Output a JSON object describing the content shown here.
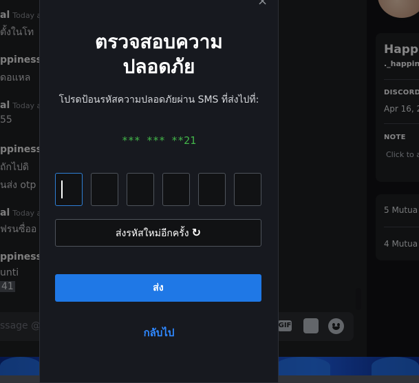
{
  "chat": {
    "messages": [
      {
        "author": "al",
        "time": "Today a",
        "body": "ตั้งในโท"
      },
      {
        "author": "ppiness",
        "time": "",
        "body": "ดอแหล"
      },
      {
        "author": "al",
        "time": "Today a",
        "body": "55"
      },
      {
        "author": "ppiness",
        "time": "",
        "body": "ถักไปดิ"
      },
      {
        "author": "",
        "time": "",
        "body": "นส่ง otp"
      },
      {
        "author": "al",
        "time": "Today a",
        "body": "ฟรนซื่ออ"
      },
      {
        "author": "ppiness",
        "time": "",
        "body": "unti"
      },
      {
        "author": "",
        "time": "",
        "body": "41"
      }
    ],
    "input_placeholder": "ssage @H",
    "gif_label": "GIF"
  },
  "profile": {
    "name": "Happi",
    "handle": "._happin",
    "member_since_label": "DISCORD",
    "member_since_value": "Apr 16, 2",
    "note_label": "NOTE",
    "note_placeholder": "Click to a",
    "mutual_1": "5 Mutua",
    "mutual_2": "4 Mutua"
  },
  "modal": {
    "close": "×",
    "title_line1": "ตรวจสอบความ",
    "title_line2": "ปลอดภัย",
    "subtitle": "โปรดป้อนรหัสความปลอดภัยผ่าน SMS ที่ส่งไปที่:",
    "phone": "*** *** **21",
    "otp_length": 6,
    "resend_label": "ส่งรหัสใหม่อีกครั้ง",
    "resend_icon": "↻",
    "submit_label": "ส่ง",
    "back_label": "กลับไป"
  },
  "colors": {
    "accent": "#1f78e6",
    "phone_green": "#43b54a",
    "link": "#2f88ff"
  }
}
